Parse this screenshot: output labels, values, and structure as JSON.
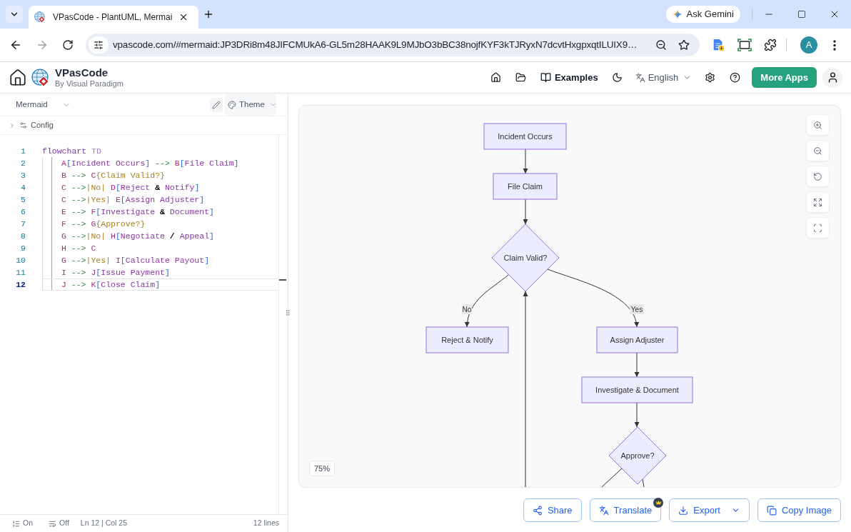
{
  "browser": {
    "tab_title": "VPasCode - PlantUML, Mermai",
    "ask_gemini": "Ask Gemini",
    "url": "vpascode.com/#mermaid:JP3DRi8m48JIFCMUkA6-GL5m28HAAK9L9MJbO3bBC38nojfKYF3kTJRyxN7dcvtHxgpxqtILUIX9…",
    "profile_initial": "A"
  },
  "header": {
    "brand": "VPasCode",
    "tagline": "By Visual Paradigm",
    "examples": "Examples",
    "language": "English",
    "more_apps": "More Apps"
  },
  "editor": {
    "language": "Mermaid",
    "theme": "Theme",
    "config": "Config",
    "lines": [
      {
        "number": "1",
        "active": false,
        "tokens": [
          {
            "kind": "keyword",
            "text": "flowchart"
          },
          {
            "kind": "direction",
            "text": " TD"
          }
        ],
        "children": [
          {
            "number": "2",
            "active": false,
            "tokens": [
              {
                "kind": "id",
                "text": "A"
              },
              {
                "kind": "bracket",
                "text": "["
              },
              {
                "kind": "label",
                "text": "Incident Occurs"
              },
              {
                "kind": "bracket",
                "text": "]"
              },
              {
                "kind": "arrow",
                "text": " --> "
              },
              {
                "kind": "id",
                "text": "B"
              },
              {
                "kind": "bracket",
                "text": "["
              },
              {
                "kind": "label",
                "text": "File Claim"
              },
              {
                "kind": "bracket",
                "text": "]"
              }
            ]
          },
          {
            "number": "3",
            "active": false,
            "tokens": [
              {
                "kind": "id",
                "text": "B"
              },
              {
                "kind": "arrow",
                "text": " --> "
              },
              {
                "kind": "id",
                "text": "C"
              },
              {
                "kind": "decision",
                "text": "{Claim Valid?}"
              }
            ]
          },
          {
            "number": "4",
            "active": false,
            "tokens": [
              {
                "kind": "id",
                "text": "C"
              },
              {
                "kind": "arrow",
                "text": " -->"
              },
              {
                "kind": "edge",
                "text": "|No|"
              },
              {
                "kind": "id",
                "text": " D"
              },
              {
                "kind": "bracket",
                "text": "["
              },
              {
                "kind": "label",
                "text": "Reject "
              },
              {
                "kind": "op",
                "text": "&"
              },
              {
                "kind": "label",
                "text": " Notify"
              },
              {
                "kind": "bracket",
                "text": "]"
              }
            ]
          },
          {
            "number": "5",
            "active": false,
            "tokens": [
              {
                "kind": "id",
                "text": "C"
              },
              {
                "kind": "arrow",
                "text": " -->"
              },
              {
                "kind": "edge",
                "text": "|Yes|"
              },
              {
                "kind": "id",
                "text": " E"
              },
              {
                "kind": "bracket",
                "text": "["
              },
              {
                "kind": "label",
                "text": "Assign Adjuster"
              },
              {
                "kind": "bracket",
                "text": "]"
              }
            ]
          },
          {
            "number": "6",
            "active": false,
            "tokens": [
              {
                "kind": "id",
                "text": "E"
              },
              {
                "kind": "arrow",
                "text": " --> "
              },
              {
                "kind": "id",
                "text": "F"
              },
              {
                "kind": "bracket",
                "text": "["
              },
              {
                "kind": "label",
                "text": "Investigate "
              },
              {
                "kind": "op",
                "text": "&"
              },
              {
                "kind": "label",
                "text": " Document"
              },
              {
                "kind": "bracket",
                "text": "]"
              }
            ]
          },
          {
            "number": "7",
            "active": false,
            "tokens": [
              {
                "kind": "id",
                "text": "F"
              },
              {
                "kind": "arrow",
                "text": " --> "
              },
              {
                "kind": "id",
                "text": "G"
              },
              {
                "kind": "decision",
                "text": "{Approve?}"
              }
            ]
          },
          {
            "number": "8",
            "active": false,
            "tokens": [
              {
                "kind": "id",
                "text": "G"
              },
              {
                "kind": "arrow",
                "text": " -->"
              },
              {
                "kind": "edge",
                "text": "|No|"
              },
              {
                "kind": "id",
                "text": " H"
              },
              {
                "kind": "bracket",
                "text": "["
              },
              {
                "kind": "label",
                "text": "Negotiate "
              },
              {
                "kind": "op",
                "text": "/"
              },
              {
                "kind": "label",
                "text": " Appeal"
              },
              {
                "kind": "bracket",
                "text": "]"
              }
            ]
          },
          {
            "number": "9",
            "active": false,
            "tokens": [
              {
                "kind": "id",
                "text": "H"
              },
              {
                "kind": "arrow",
                "text": " --> "
              },
              {
                "kind": "id",
                "text": "C"
              }
            ]
          },
          {
            "number": "10",
            "active": false,
            "tokens": [
              {
                "kind": "id",
                "text": "G"
              },
              {
                "kind": "arrow",
                "text": " -->"
              },
              {
                "kind": "edge",
                "text": "|Yes|"
              },
              {
                "kind": "id",
                "text": " I"
              },
              {
                "kind": "bracket",
                "text": "["
              },
              {
                "kind": "label",
                "text": "Calculate Payout"
              },
              {
                "kind": "bracket",
                "text": "]"
              }
            ]
          },
          {
            "number": "11",
            "active": false,
            "tokens": [
              {
                "kind": "id",
                "text": "I"
              },
              {
                "kind": "arrow",
                "text": " --> "
              },
              {
                "kind": "id",
                "text": "J"
              },
              {
                "kind": "bracket",
                "text": "["
              },
              {
                "kind": "label",
                "text": "Issue Payment"
              },
              {
                "kind": "bracket",
                "text": "]"
              }
            ]
          },
          {
            "number": "12",
            "active": true,
            "tokens": [
              {
                "kind": "id",
                "text": "J"
              },
              {
                "kind": "arrow",
                "text": " --> "
              },
              {
                "kind": "id",
                "text": "K"
              },
              {
                "kind": "bracket",
                "text": "["
              },
              {
                "kind": "label",
                "text": "Close Claim"
              },
              {
                "kind": "bracket",
                "text": "]"
              }
            ]
          }
        ]
      }
    ],
    "status": {
      "line_numbers": "On",
      "word_wrap": "Off",
      "cursor": "Ln 12 | Col 25",
      "line_count": "12 lines"
    }
  },
  "preview": {
    "nodes": [
      {
        "kind": "process",
        "label": "Incident Occurs"
      },
      {
        "kind": "process",
        "label": "File Claim"
      },
      {
        "kind": "decision",
        "label": "Claim Valid?"
      },
      {
        "kind": "process",
        "label": "Reject & Notify"
      },
      {
        "kind": "process",
        "label": "Assign Adjuster"
      },
      {
        "kind": "process",
        "label": "Investigate & Document"
      },
      {
        "kind": "decision",
        "label": "Approve?"
      }
    ],
    "edge_labels": [
      "No",
      "Yes"
    ],
    "zoom": "75%"
  },
  "actions": [
    {
      "kind": "share",
      "label": "Share",
      "premium": false
    },
    {
      "kind": "translate",
      "label": "Translate",
      "premium": true
    },
    {
      "kind": "export",
      "label": "Export",
      "premium": false
    },
    {
      "kind": "copy",
      "label": "Copy Image",
      "premium": false
    }
  ]
}
